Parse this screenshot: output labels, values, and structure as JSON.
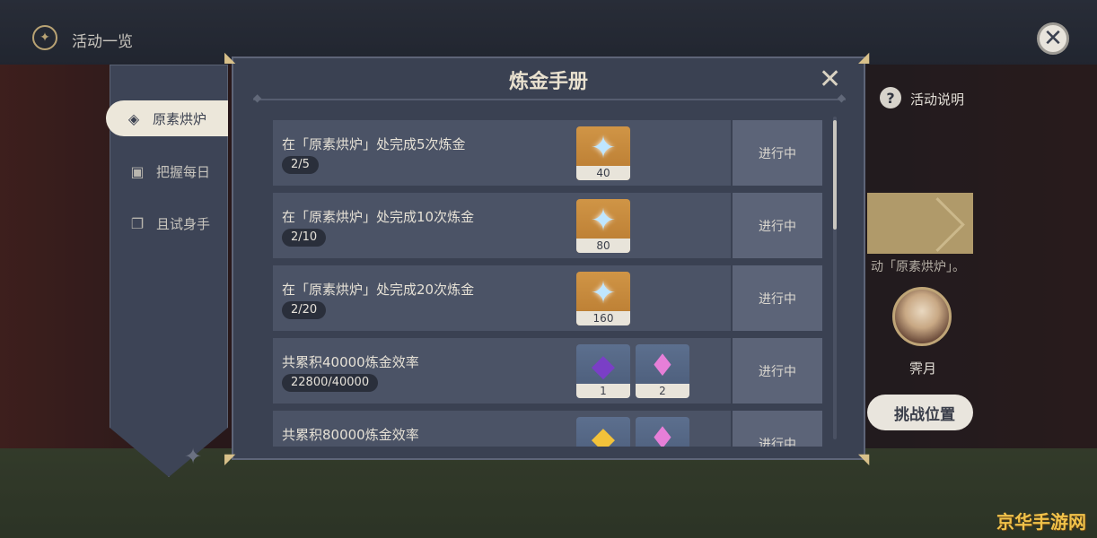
{
  "header": {
    "title": "活动一览",
    "icon": "compass-icon",
    "close_icon": "close-icon"
  },
  "sidebar": {
    "items": [
      {
        "label": "原素烘炉",
        "icon": "element-furnace-icon",
        "active": true
      },
      {
        "label": "把握每日",
        "icon": "calendar-icon",
        "active": false
      },
      {
        "label": "且试身手",
        "icon": "cards-icon",
        "active": false
      }
    ]
  },
  "background_panel": {
    "help_label": "活动说明",
    "hint_text": "动「原素烘炉」。",
    "avatar_name": "霁月",
    "challenge_button": "挑战位置"
  },
  "dialog": {
    "title": "炼金手册",
    "close_icon": "close-icon",
    "tasks": [
      {
        "task": "在「原素烘炉」处完成5次炼金",
        "progress": "2/5",
        "status": "进行中",
        "rewards": [
          {
            "icon": "primogem-icon",
            "qty": "40"
          }
        ]
      },
      {
        "task": "在「原素烘炉」处完成10次炼金",
        "progress": "2/10",
        "status": "进行中",
        "rewards": [
          {
            "icon": "primogem-icon",
            "qty": "80"
          }
        ]
      },
      {
        "task": "在「原素烘炉」处完成20次炼金",
        "progress": "2/20",
        "status": "进行中",
        "rewards": [
          {
            "icon": "primogem-icon",
            "qty": "160"
          }
        ]
      },
      {
        "task": "共累积40000炼金效率",
        "progress": "22800/40000",
        "status": "进行中",
        "rewards": [
          {
            "icon": "purple-crystal-icon",
            "qty": "1"
          },
          {
            "icon": "pink-crystal-cluster-icon",
            "qty": "2"
          }
        ]
      },
      {
        "task": "共累积80000炼金效率",
        "progress": "",
        "status": "进行中",
        "rewards": [
          {
            "icon": "gold-crystal-icon",
            "qty": ""
          },
          {
            "icon": "pink-crystal-cluster-icon",
            "qty": ""
          }
        ]
      }
    ]
  },
  "watermark": "京华手游网",
  "colors": {
    "accent_gold": "#d8c08a",
    "panel": "#3a4152",
    "row": "#4b5366",
    "status_cell": "#5c6478"
  }
}
